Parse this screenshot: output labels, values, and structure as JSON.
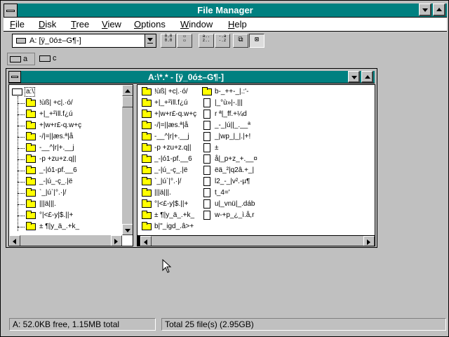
{
  "app": {
    "title": "File Manager"
  },
  "menu": [
    {
      "label": "File",
      "u": "F",
      "rest": "ile"
    },
    {
      "label": "Disk",
      "u": "D",
      "rest": "isk"
    },
    {
      "label": "Tree",
      "u": "T",
      "rest": "ree"
    },
    {
      "label": "View",
      "u": "V",
      "rest": "iew"
    },
    {
      "label": "Options",
      "u": "O",
      "rest": "ptions"
    },
    {
      "label": "Window",
      "u": "W",
      "rest": "indow"
    },
    {
      "label": "Help",
      "u": "H",
      "rest": "elp"
    }
  ],
  "toolbar": {
    "drive_value": "A: [ÿ_0ó±–G¶-]",
    "buttons": [
      "connect-net-drive-button",
      "disconnect-net-drive-button",
      "view-by-name-button",
      "view-all-details-button",
      "sort-by-name-button",
      "sort-by-type-button",
      "view-tree-and-dir-button",
      "view-partial-details-button"
    ]
  },
  "drives": [
    {
      "label": "a",
      "selected": true
    },
    {
      "label": "c",
      "selected": false
    }
  ],
  "child": {
    "title": "A:\\*.* - [ÿ_0ó±–G¶-]"
  },
  "tree": {
    "root": "a:\\",
    "items": [
      "!ùß| +c|.·ó/",
      "+|_+²ìll.f¿ú",
      "+|w+r£-q.w+ç",
      "-/|=||æs.ª|å",
      "-__^|r|+.__j",
      "-p +zu+z.q||",
      "_-|ó1-pf.__6",
      "_-|ú_-ç_.|ë",
      "`_|ú`|°.·|/",
      "|||ä|||.",
      "°|<£-y|$.||+",
      "± ¶|y_ä_.+k_"
    ]
  },
  "files": {
    "col1": [
      {
        "type": "folder",
        "name": "!ùß| +c|.·ó/"
      },
      {
        "type": "folder",
        "name": "+|_+²ìll.f¿ú"
      },
      {
        "type": "folder",
        "name": "+|w+r£-q.w+ç"
      },
      {
        "type": "folder",
        "name": "-/|=||æs.ª|å"
      },
      {
        "type": "folder",
        "name": "-__^|r|+.__j"
      },
      {
        "type": "folder",
        "name": "-p +zu+z.q||"
      },
      {
        "type": "folder",
        "name": "_-|ó1-pf.__6"
      },
      {
        "type": "folder",
        "name": "_-|ú_-ç_.|ë"
      },
      {
        "type": "folder",
        "name": "`_|ú`|°.·|/"
      },
      {
        "type": "folder",
        "name": "|||ä|||."
      },
      {
        "type": "folder",
        "name": "°|<£-y|$.||+"
      },
      {
        "type": "folder",
        "name": "± ¶|y_ä_.+k_"
      },
      {
        "type": "folder",
        "name": "b|\"_igd_.â>+"
      }
    ],
    "col2": [
      {
        "type": "folder",
        "name": "b-_++-_|.:'-"
      },
      {
        "type": "file",
        "name": "|_°ù»|-.|||"
      },
      {
        "type": "file",
        "name": "r ª|_ff.+¼d"
      },
      {
        "type": "file",
        "name": "_-_|ú||_.__ª"
      },
      {
        "type": "file",
        "name": "_|wp_|_|.|+!"
      },
      {
        "type": "file",
        "name": "±"
      },
      {
        "type": "file",
        "name": "å|_p+z_+.__¤"
      },
      {
        "type": "file",
        "name": "ëä_²|q2â.+_|"
      },
      {
        "type": "file",
        "name": "l2_-_|v².-µ¶"
      },
      {
        "type": "file",
        "name": "t_4='"
      },
      {
        "type": "file",
        "name": "u|_vnü|_.dáb"
      },
      {
        "type": "file",
        "name": "w-+p_¿_ì.å,r"
      }
    ]
  },
  "status": {
    "left": "A: 52.0KB free,  1.15MB total",
    "right": "Total 25 file(s) (2.95GB)"
  },
  "colors": {
    "titlebar": "#008080",
    "folder": "#ffff00",
    "face": "#c0c0c0"
  }
}
